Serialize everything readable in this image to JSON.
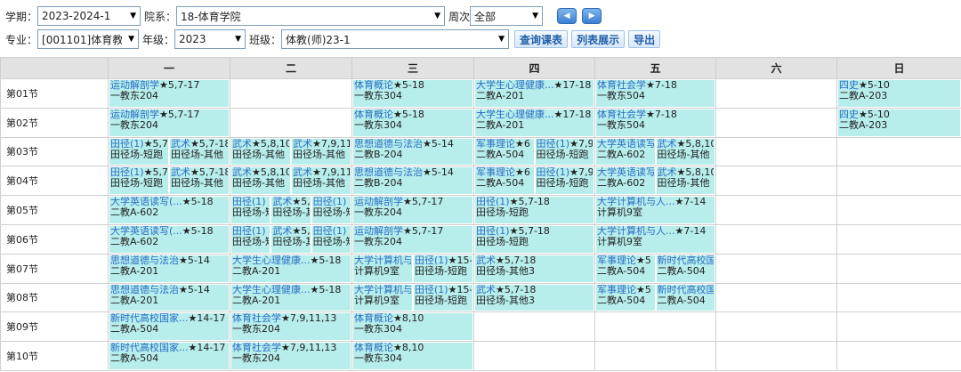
{
  "filters": {
    "term_label": "学期：",
    "term_value": "2023-2024-1",
    "dept_label": "院系：",
    "dept_value": "18-体育学院",
    "week_label": "周次",
    "week_value": "全部",
    "major_label": "专业：",
    "major_value": "[001101]体育教育",
    "grade_label": "年级：",
    "grade_value": "2023",
    "class_label": "班级：",
    "class_value": "体教(师)23-1",
    "query_button": "查询课表",
    "list_button": "列表展示",
    "export_button": "导出"
  },
  "headers": [
    "",
    "一",
    "二",
    "三",
    "四",
    "五",
    "六",
    "日"
  ],
  "periods": [
    "第01节",
    "第02节",
    "第03节",
    "第04节",
    "第05节",
    "第06节",
    "第07节",
    "第08节",
    "第09节",
    "第10节"
  ],
  "grid": [
    [
      [
        {
          "c": "运动解剖学",
          "w": "★5,7-17",
          "r": "一教东204"
        }
      ],
      [],
      [
        {
          "c": "体育概论",
          "w": "★5-18",
          "r": "一教东304"
        }
      ],
      [
        {
          "c": "大学生心理健康...",
          "w": "★17-18",
          "r": "二教A-201"
        }
      ],
      [
        {
          "c": "体育社会学",
          "w": "★7-18",
          "r": "一教东504"
        }
      ],
      [],
      [
        {
          "c": "四史",
          "w": "★5-10",
          "r": "二教A-203"
        }
      ]
    ],
    [
      [
        {
          "c": "运动解剖学",
          "w": "★5,7-17",
          "r": "一教东204"
        }
      ],
      [],
      [
        {
          "c": "体育概论",
          "w": "★5-18",
          "r": "一教东304"
        }
      ],
      [
        {
          "c": "大学生心理健康...",
          "w": "★17-18",
          "r": "二教A-201"
        }
      ],
      [
        {
          "c": "体育社会学",
          "w": "★7-18",
          "r": "一教东504"
        }
      ],
      [],
      [
        {
          "c": "四史",
          "w": "★5-10",
          "r": "二教A-203"
        }
      ]
    ],
    [
      [
        {
          "c": "田径(1)",
          "w": "★5,7",
          "r": "田径场-短跑"
        },
        {
          "c": "武术",
          "w": "★5,7-18",
          "r": "田径场-其他"
        }
      ],
      [
        {
          "c": "武术",
          "w": "★5,8,10",
          "r": "田径场-其他"
        },
        {
          "c": "武术",
          "w": "★7,9,11",
          "r": "田径场-其他"
        }
      ],
      [
        {
          "c": "思想道德与法治",
          "w": "★5-14",
          "r": "二教B-204"
        }
      ],
      [
        {
          "c": "军事理论",
          "w": "★6",
          "r": "二教A-504"
        },
        {
          "c": "田径(1)",
          "w": "★7,9",
          "r": "田径场-短跑"
        }
      ],
      [
        {
          "c": "大学英语读写",
          "w": "",
          "r": "二教A-602"
        },
        {
          "c": "武术",
          "w": "★5,8,10",
          "r": "田径场-其他"
        }
      ],
      [],
      []
    ],
    [
      [
        {
          "c": "田径(1)",
          "w": "★5,7",
          "r": "田径场-短跑"
        },
        {
          "c": "武术",
          "w": "★5,7-18",
          "r": "田径场-其他"
        }
      ],
      [
        {
          "c": "武术",
          "w": "★5,8,10",
          "r": "田径场-其他"
        },
        {
          "c": "武术",
          "w": "★7,9,11",
          "r": "田径场-其他"
        }
      ],
      [
        {
          "c": "思想道德与法治",
          "w": "★5-14",
          "r": "二教B-204"
        }
      ],
      [
        {
          "c": "军事理论",
          "w": "★6",
          "r": "二教A-504"
        },
        {
          "c": "田径(1)",
          "w": "★7,9",
          "r": "田径场-短跑"
        }
      ],
      [
        {
          "c": "大学英语读写",
          "w": "",
          "r": "二教A-602"
        },
        {
          "c": "武术",
          "w": "★5,8,10",
          "r": "田径场-其他"
        }
      ],
      [],
      []
    ],
    [
      [
        {
          "c": "大学英语读写(...",
          "w": "★5-18",
          "r": "二教A-602"
        }
      ],
      [
        {
          "c": "田径(1)",
          "w": "",
          "r": "田径场-短"
        },
        {
          "c": "武术",
          "w": "★5,",
          "r": "田径场-其"
        },
        {
          "c": "田径(1)",
          "w": "",
          "r": "田径场-短"
        }
      ],
      [
        {
          "c": "运动解剖学",
          "w": "★5,7-17",
          "r": "一教东204"
        }
      ],
      [
        {
          "c": "田径(1)",
          "w": "★5,7-18",
          "r": "田径场-短跑"
        }
      ],
      [
        {
          "c": "大学计算机与人...",
          "w": "★7-14",
          "r": "计算机9室"
        }
      ],
      [],
      []
    ],
    [
      [
        {
          "c": "大学英语读写(...",
          "w": "★5-18",
          "r": "二教A-602"
        }
      ],
      [
        {
          "c": "田径(1)",
          "w": "",
          "r": "田径场-短"
        },
        {
          "c": "武术",
          "w": "★5,",
          "r": "田径场-其"
        },
        {
          "c": "田径(1)",
          "w": "",
          "r": "田径场-短"
        }
      ],
      [
        {
          "c": "运动解剖学",
          "w": "★5,7-17",
          "r": "一教东204"
        }
      ],
      [
        {
          "c": "田径(1)",
          "w": "★5,7-18",
          "r": "田径场-短跑"
        }
      ],
      [
        {
          "c": "大学计算机与人...",
          "w": "★7-14",
          "r": "计算机9室"
        }
      ],
      [],
      []
    ],
    [
      [
        {
          "c": "思想道德与法治",
          "w": "★5-14",
          "r": "二教A-201"
        }
      ],
      [
        {
          "c": "大学生心理健康...",
          "w": "★5-18",
          "r": "二教A-201"
        }
      ],
      [
        {
          "c": "大学计算机与",
          "w": "",
          "r": "计算机9室"
        },
        {
          "c": "田径(1)",
          "w": "★15-",
          "r": "田径场-短跑"
        }
      ],
      [
        {
          "c": "武术",
          "w": "★5,7-18",
          "r": "田径场-其他3"
        }
      ],
      [
        {
          "c": "军事理论",
          "w": "★5",
          "r": "二教A-504"
        },
        {
          "c": "新时代高校国",
          "w": "",
          "r": "二教A-504"
        }
      ],
      [],
      []
    ],
    [
      [
        {
          "c": "思想道德与法治",
          "w": "★5-14",
          "r": "二教A-201"
        }
      ],
      [
        {
          "c": "大学生心理健康...",
          "w": "★5-18",
          "r": "二教A-201"
        }
      ],
      [
        {
          "c": "大学计算机与",
          "w": "",
          "r": "计算机9室"
        },
        {
          "c": "田径(1)",
          "w": "★15-",
          "r": "田径场-短跑"
        }
      ],
      [
        {
          "c": "武术",
          "w": "★5,7-18",
          "r": "田径场-其他3"
        }
      ],
      [
        {
          "c": "军事理论",
          "w": "★5",
          "r": "二教A-504"
        },
        {
          "c": "新时代高校国",
          "w": "",
          "r": "二教A-504"
        }
      ],
      [],
      []
    ],
    [
      [
        {
          "c": "新时代高校国家...",
          "w": "★14-17",
          "r": "二教A-504"
        }
      ],
      [
        {
          "c": "体育社会学",
          "w": "★7,9,11,13",
          "r": "一教东204"
        }
      ],
      [
        {
          "c": "体育概论",
          "w": "★8,10",
          "r": "一教东304"
        }
      ],
      [],
      [],
      [],
      []
    ],
    [
      [
        {
          "c": "新时代高校国家...",
          "w": "★14-17",
          "r": "二教A-504"
        }
      ],
      [
        {
          "c": "体育社会学",
          "w": "★7,9,11,13",
          "r": "一教东204"
        }
      ],
      [
        {
          "c": "体育概论",
          "w": "★8,10",
          "r": "一教东304"
        }
      ],
      [],
      [],
      [],
      []
    ]
  ]
}
